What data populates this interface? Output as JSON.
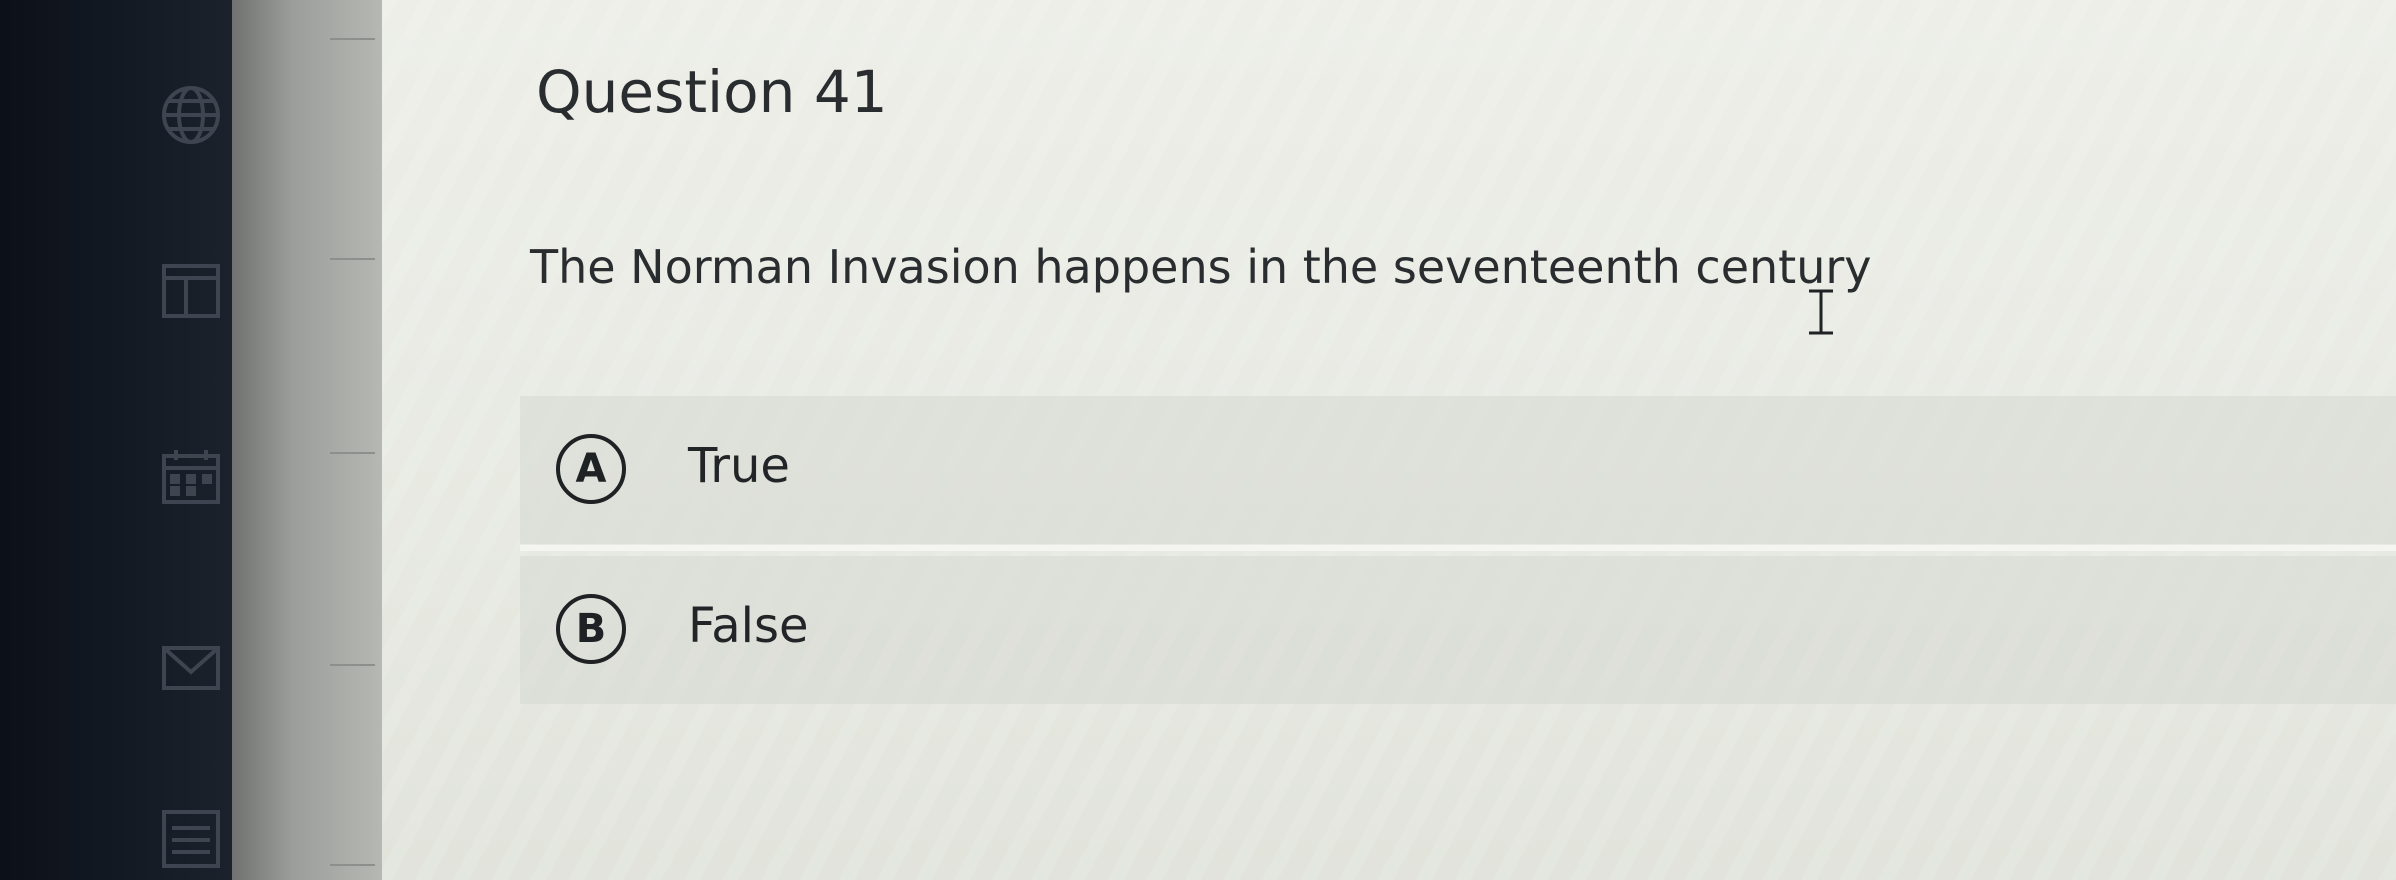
{
  "sidebar": {
    "icons": [
      "globe-icon",
      "layout-icon",
      "calendar-icon",
      "mail-icon",
      "list-icon"
    ]
  },
  "question": {
    "title": "Question 41",
    "text": "The Norman Invasion happens in the seventeenth century"
  },
  "options": [
    {
      "letter": "A",
      "label": "True"
    },
    {
      "letter": "B",
      "label": "False"
    }
  ],
  "colors": {
    "rail": "#121822",
    "panel": "#9a9d99",
    "background": "#e9ebe3",
    "text": "#2a2d2f"
  }
}
